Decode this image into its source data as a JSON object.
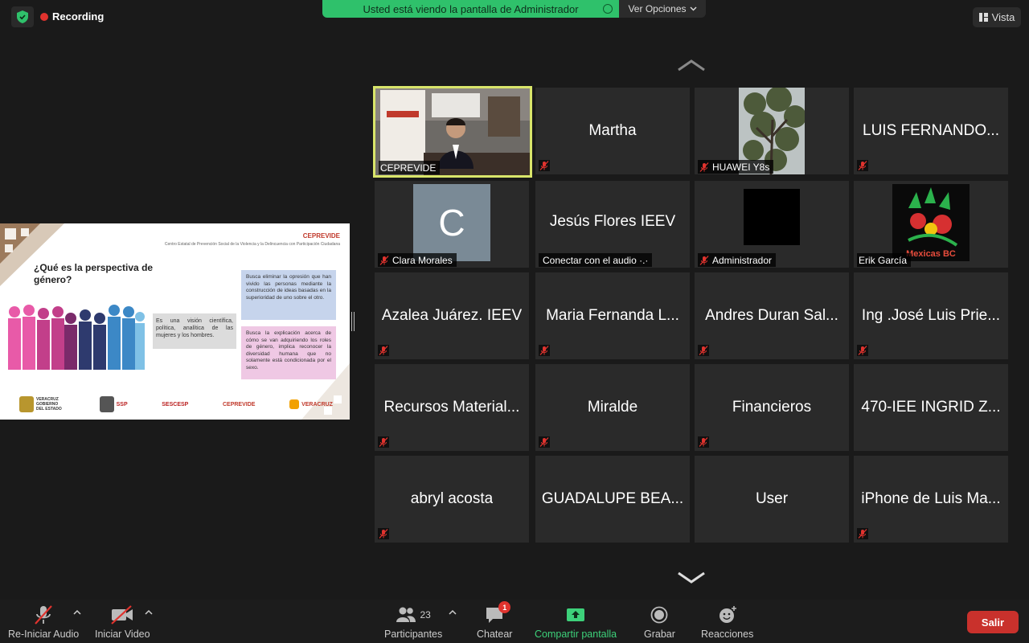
{
  "recording": {
    "label": "Recording"
  },
  "banner": {
    "text": "Usted está viendo la pantalla de Administrador",
    "view_options": "Ver Opciones"
  },
  "view": {
    "label": "Vista"
  },
  "slide": {
    "brand": "CEPREVIDE",
    "subtitle": "Centro Estatal de Prevención Social de la Violencia y la Delincuencia con Participación Ciudadana",
    "title": "¿Qué es la perspectiva de género?",
    "mid_text": "Es una visión científica, política, analítica de las mujeres y los hombres.",
    "blue_text": "Busca eliminar la opresión que han vivido las personas mediante la construcción de ideas basadas en la superioridad de uno sobre el otro.",
    "pink_text": "Busca la explicación acerca de cómo se van adquiriendo los roles de género, implica reconocer la diversidad humana que no solamente está condicionada por el sexo.",
    "logos": [
      "VERACRUZ GOBIERNO DEL ESTADO",
      "SSP",
      "SESCESP",
      "CEPREVIDE",
      "VERACRUZ"
    ]
  },
  "gallery": {
    "tiles": [
      {
        "name": "",
        "tag": "CEPREVIDE",
        "muted": false,
        "kind": "video"
      },
      {
        "name": "Martha",
        "tag": "",
        "muted": true,
        "kind": "name"
      },
      {
        "name": "",
        "tag": "HUAWEI Y8s",
        "muted": true,
        "kind": "tree"
      },
      {
        "name": "LUIS FERNANDO...",
        "tag": "",
        "muted": true,
        "kind": "name"
      },
      {
        "name": "",
        "tag": "Clara Morales",
        "muted": true,
        "kind": "avatar",
        "initial": "C"
      },
      {
        "name": "Jesús Flores IEEV",
        "tag": "Conectar con el audio ·.·",
        "muted": false,
        "kind": "name-tag"
      },
      {
        "name": "",
        "tag": "Administrador",
        "muted": true,
        "kind": "black"
      },
      {
        "name": "",
        "tag": "Erik García",
        "muted": false,
        "kind": "logo",
        "logo_text": "Mexicas BC"
      },
      {
        "name": "Azalea Juárez. IEEV",
        "tag": "",
        "muted": true,
        "kind": "name"
      },
      {
        "name": "Maria Fernanda L...",
        "tag": "",
        "muted": true,
        "kind": "name"
      },
      {
        "name": "Andres Duran Sal...",
        "tag": "",
        "muted": true,
        "kind": "name"
      },
      {
        "name": "Ing .José Luis Prie...",
        "tag": "",
        "muted": true,
        "kind": "name"
      },
      {
        "name": "Recursos Material...",
        "tag": "",
        "muted": true,
        "kind": "name"
      },
      {
        "name": "Miralde",
        "tag": "",
        "muted": true,
        "kind": "name"
      },
      {
        "name": "Financieros",
        "tag": "",
        "muted": true,
        "kind": "name"
      },
      {
        "name": "470-IEE INGRID Z...",
        "tag": "",
        "muted": false,
        "kind": "name"
      },
      {
        "name": "abryl acosta",
        "tag": "",
        "muted": true,
        "kind": "name"
      },
      {
        "name": "GUADALUPE BEA...",
        "tag": "",
        "muted": false,
        "kind": "name"
      },
      {
        "name": "User",
        "tag": "",
        "muted": false,
        "kind": "name"
      },
      {
        "name": "iPhone de Luis Ma...",
        "tag": "",
        "muted": true,
        "kind": "name"
      }
    ]
  },
  "toolbar": {
    "audio": "Re-Iniciar Audio",
    "video": "Iniciar Video",
    "participants": "Participantes",
    "participants_count": "23",
    "chat": "Chatear",
    "chat_badge": "1",
    "share": "Compartir pantalla",
    "record": "Grabar",
    "reactions": "Reacciones",
    "leave": "Salir"
  },
  "colors": {
    "share_green": "#3dd17a",
    "leave_red": "#c9312c",
    "active_border": "#d9e56a",
    "banner_green": "#2fc16b"
  }
}
